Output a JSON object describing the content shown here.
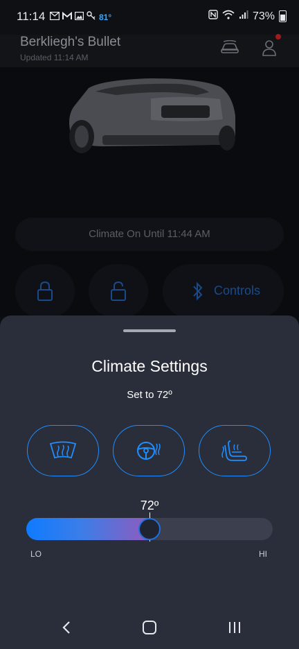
{
  "status_bar": {
    "time": "11:14",
    "temperature": "81°",
    "battery": "73%"
  },
  "header": {
    "vehicle_name": "Berkliegh's Bullet",
    "updated": "Updated 11:14 AM"
  },
  "climate_status": "Climate On Until 11:44 AM",
  "controls_label": "Controls",
  "sheet": {
    "title": "Climate Settings",
    "subtitle": "Set to 72º",
    "temperature_value": "72º",
    "slider": {
      "min_label": "LO",
      "max_label": "HI",
      "fraction": 0.5
    },
    "options": [
      {
        "icon": "windshield-defrost-icon"
      },
      {
        "icon": "heated-steering-wheel-icon"
      },
      {
        "icon": "heated-seat-icon"
      }
    ]
  },
  "colors": {
    "accent": "#1f8fff",
    "sheet_bg": "#2a2d3a",
    "slider_track": "#3b3f4e"
  }
}
